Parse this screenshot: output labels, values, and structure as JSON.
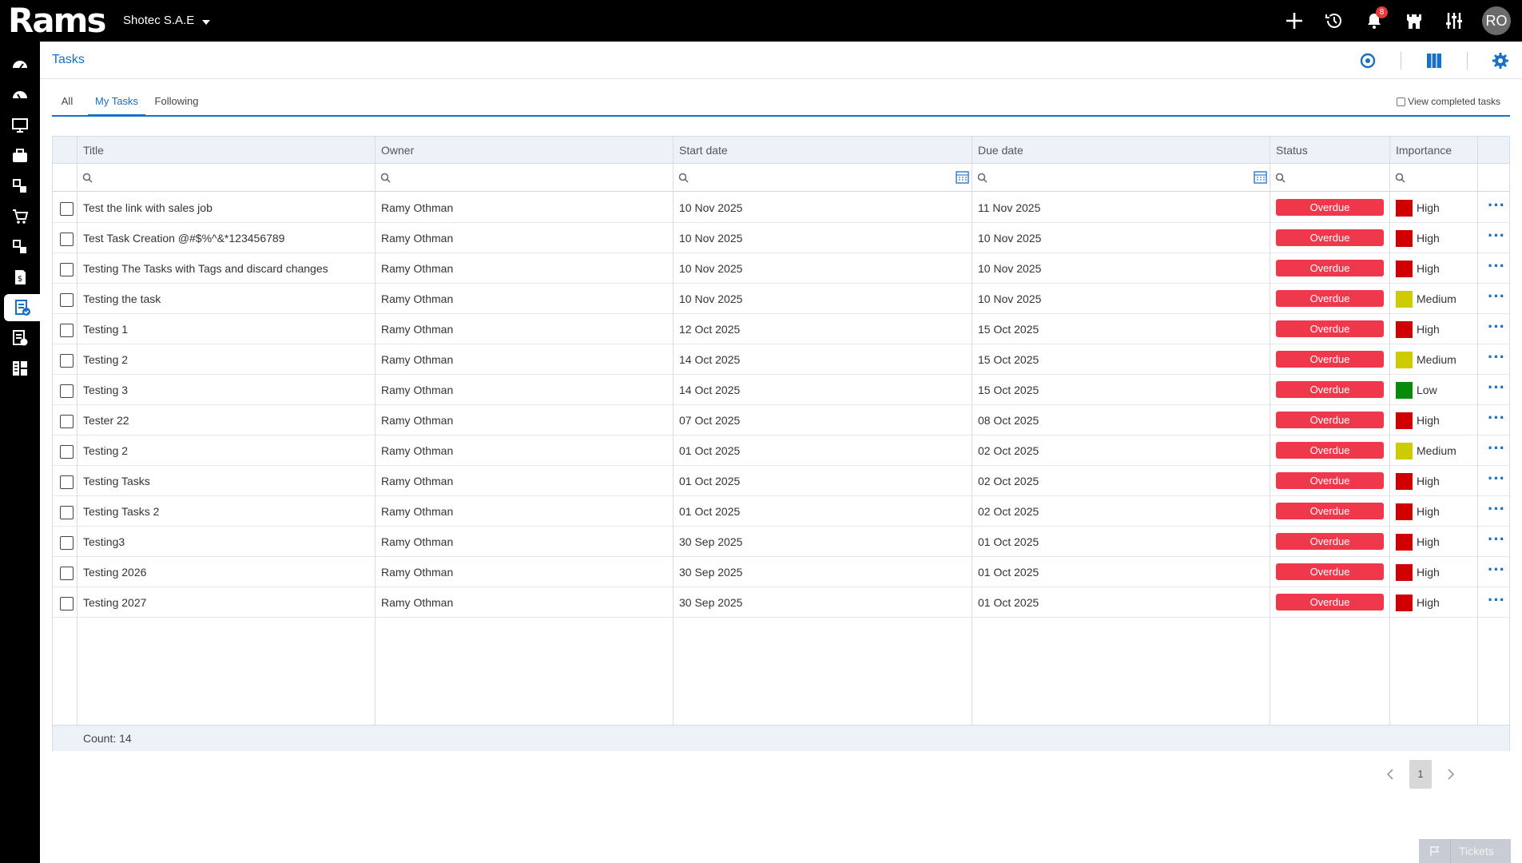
{
  "brand": {
    "logo_text": "Rams"
  },
  "company": {
    "name": "Shotec S.A.E"
  },
  "topbar": {
    "notifications_count": "8",
    "avatar_initials": "RO"
  },
  "page": {
    "title": "Tasks"
  },
  "tabs": [
    {
      "label": "All"
    },
    {
      "label": "My Tasks",
      "active": true
    },
    {
      "label": "Following"
    }
  ],
  "view_completed_label": "View completed tasks",
  "columns": [
    "Title",
    "Owner",
    "Start date",
    "Due date",
    "Status",
    "Importance"
  ],
  "importance_colors": {
    "High": "#d10000",
    "Medium": "#cccc00",
    "Low": "#0a8a0a"
  },
  "status_color": "#f0384d",
  "rows": [
    {
      "title": "Test the link with sales job",
      "owner": "Ramy Othman",
      "start": "10 Nov 2025",
      "due": "11 Nov 2025",
      "status": "Overdue",
      "importance": "High"
    },
    {
      "title": "Test Task Creation @#$%^&*123456789",
      "owner": "Ramy Othman",
      "start": "10 Nov 2025",
      "due": "10 Nov 2025",
      "status": "Overdue",
      "importance": "High"
    },
    {
      "title": "Testing The Tasks with Tags and discard changes",
      "owner": "Ramy Othman",
      "start": "10 Nov 2025",
      "due": "10 Nov 2025",
      "status": "Overdue",
      "importance": "High"
    },
    {
      "title": "Testing the task",
      "owner": "Ramy Othman",
      "start": "10 Nov 2025",
      "due": "10 Nov 2025",
      "status": "Overdue",
      "importance": "Medium"
    },
    {
      "title": "Testing 1",
      "owner": "Ramy Othman",
      "start": "12 Oct 2025",
      "due": "15 Oct 2025",
      "status": "Overdue",
      "importance": "High"
    },
    {
      "title": "Testing 2",
      "owner": "Ramy Othman",
      "start": "14 Oct 2025",
      "due": "15 Oct 2025",
      "status": "Overdue",
      "importance": "Medium"
    },
    {
      "title": "Testing 3",
      "owner": "Ramy Othman",
      "start": "14 Oct 2025",
      "due": "15 Oct 2025",
      "status": "Overdue",
      "importance": "Low"
    },
    {
      "title": "Tester 22",
      "owner": "Ramy Othman",
      "start": "07 Oct 2025",
      "due": "08 Oct 2025",
      "status": "Overdue",
      "importance": "High"
    },
    {
      "title": "Testing 2",
      "owner": "Ramy Othman",
      "start": "01 Oct 2025",
      "due": "02 Oct 2025",
      "status": "Overdue",
      "importance": "Medium"
    },
    {
      "title": "Testing Tasks",
      "owner": "Ramy Othman",
      "start": "01 Oct 2025",
      "due": "02 Oct 2025",
      "status": "Overdue",
      "importance": "High"
    },
    {
      "title": "Testing Tasks 2",
      "owner": "Ramy Othman",
      "start": "01 Oct 2025",
      "due": "02 Oct 2025",
      "status": "Overdue",
      "importance": "High"
    },
    {
      "title": "Testing3",
      "owner": "Ramy Othman",
      "start": "30 Sep 2025",
      "due": "01 Oct 2025",
      "status": "Overdue",
      "importance": "High"
    },
    {
      "title": "Testing 2026",
      "owner": "Ramy Othman",
      "start": "30 Sep 2025",
      "due": "01 Oct 2025",
      "status": "Overdue",
      "importance": "High"
    },
    {
      "title": "Testing 2027",
      "owner": "Ramy Othman",
      "start": "30 Sep 2025",
      "due": "01 Oct 2025",
      "status": "Overdue",
      "importance": "High"
    }
  ],
  "footer": {
    "count_label": "Count: 14"
  },
  "pager": {
    "current_page": "1"
  },
  "tickets": {
    "label": "Tickets"
  }
}
